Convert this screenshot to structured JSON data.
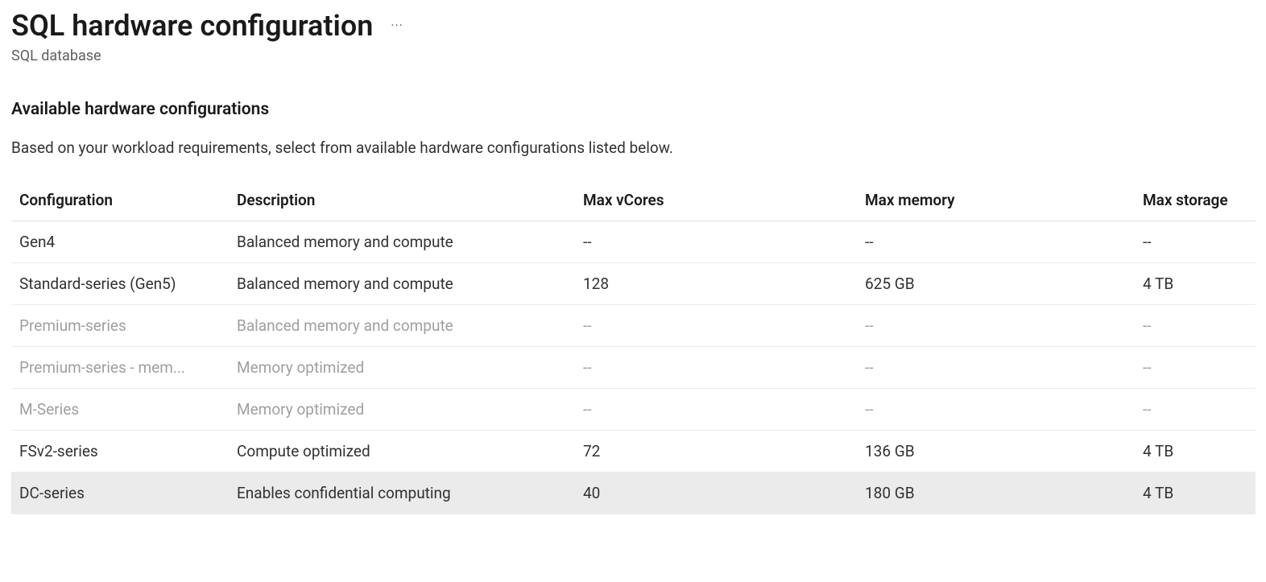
{
  "header": {
    "title": "SQL hardware configuration",
    "subtitle": "SQL database"
  },
  "section": {
    "heading": "Available hardware configurations",
    "description": "Based on your workload requirements, select from available hardware configurations listed below."
  },
  "table": {
    "columns": {
      "configuration": "Configuration",
      "description": "Description",
      "max_vcores": "Max vCores",
      "max_memory": "Max memory",
      "max_storage": "Max storage"
    },
    "rows": [
      {
        "configuration": "Gen4",
        "description": "Balanced memory and compute",
        "max_vcores": "--",
        "max_memory": "--",
        "max_storage": "--",
        "disabled": false,
        "selected": false
      },
      {
        "configuration": "Standard-series (Gen5)",
        "description": "Balanced memory and compute",
        "max_vcores": "128",
        "max_memory": "625 GB",
        "max_storage": "4 TB",
        "disabled": false,
        "selected": false
      },
      {
        "configuration": "Premium-series",
        "description": "Balanced memory and compute",
        "max_vcores": "--",
        "max_memory": "--",
        "max_storage": "--",
        "disabled": true,
        "selected": false
      },
      {
        "configuration": "Premium-series - mem...",
        "description": "Memory optimized",
        "max_vcores": "--",
        "max_memory": "--",
        "max_storage": "--",
        "disabled": true,
        "selected": false
      },
      {
        "configuration": "M-Series",
        "description": "Memory optimized",
        "max_vcores": "--",
        "max_memory": "--",
        "max_storage": "--",
        "disabled": true,
        "selected": false
      },
      {
        "configuration": "FSv2-series",
        "description": "Compute optimized",
        "max_vcores": "72",
        "max_memory": "136 GB",
        "max_storage": "4 TB",
        "disabled": false,
        "selected": false
      },
      {
        "configuration": "DC-series",
        "description": "Enables confidential computing",
        "max_vcores": "40",
        "max_memory": "180 GB",
        "max_storage": "4 TB",
        "disabled": false,
        "selected": true
      }
    ]
  }
}
